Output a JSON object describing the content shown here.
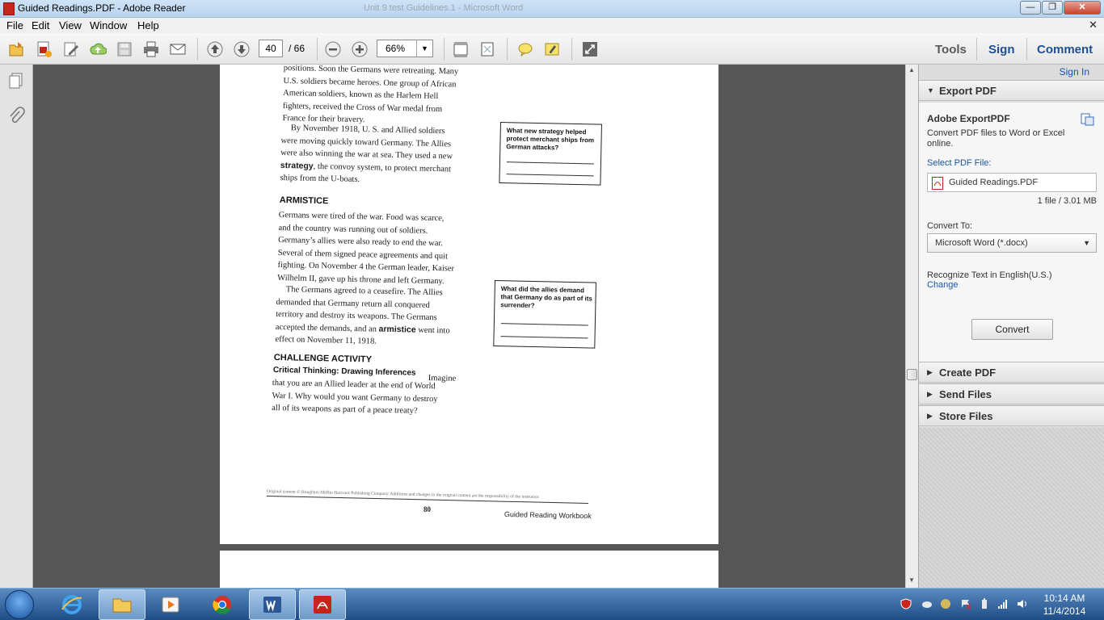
{
  "window": {
    "title": "Guided Readings.PDF - Adobe Reader",
    "ghost_title": "Unit 9 test Guidelines.1 - Microsoft Word",
    "minimize": "—",
    "maximize": "❐",
    "close": "✕"
  },
  "menu": {
    "items": [
      "File",
      "Edit",
      "View",
      "Window",
      "Help"
    ],
    "close_glyph": "✕"
  },
  "toolbar": {
    "current_page": "40",
    "page_total": "/ 66",
    "zoom": "66%",
    "zoom_dropdown": "▼",
    "tools": "Tools",
    "sign": "Sign",
    "comment": "Comment"
  },
  "document": {
    "paragraph1": [
      "positions. Soon the Germans were retreating. Many",
      "U.S. soldiers became heroes. One group of African",
      "American soldiers, known as the Harlem Hell",
      "fighters, received the Cross of War medal from",
      "France for their bravery."
    ],
    "paragraph2": [
      "By November 1918, U. S. and Allied soldiers",
      "were moving quickly toward Germany. The Allies",
      "were also winning the war at sea. They used a new",
      "strategy, the convoy system, to protect merchant",
      "ships from the U-boats."
    ],
    "heading_armistice": "ARMISTICE",
    "paragraph3": [
      "Germans were tired of the war. Food was scarce,",
      "and the country was running out of soldiers.",
      "Germany’s allies were also ready to end the war.",
      "Several of them signed peace agreements and quit",
      "fighting. On November 4 the German leader, Kaiser",
      "Wilhelm II, gave up his throne and left Germany."
    ],
    "paragraph4": [
      "The Germans agreed to a ceasefire. The Allies",
      "demanded that Germany return all conquered",
      "territory and destroy its weapons. The Germans",
      "accepted the demands, and an armistice went into",
      "effect on November 11, 1918."
    ],
    "heading_challenge": "CHALLENGE ACTIVITY",
    "challenge_sub": "Critical Thinking: Drawing Inferences",
    "challenge_text": [
      "Imagine",
      "that you are an Allied leader at the end of World",
      "War I.  Why would you want Germany to destroy",
      "all of its weapons as part of a peace treaty?"
    ],
    "question1": "What new strategy helped protect merchant ships from German attacks?",
    "question2": "What did the allies demand that Germany do as part of its surrender?",
    "footnote": "Original content © Houghton Mifflin Harcourt Publishing Company. Additions and changes to the original content are the responsibility of the instructor.",
    "page_number": "80",
    "workbook": "Guided Reading Workbook"
  },
  "right_pane": {
    "sign_in": "Sign In",
    "export_header": "Export PDF",
    "export_title": "Adobe ExportPDF",
    "export_desc": "Convert PDF files to Word or Excel online.",
    "select_label": "Select PDF File:",
    "file_name": "Guided Readings.PDF",
    "file_size": "1 file / 3.01 MB",
    "convert_to_label": "Convert To:",
    "convert_to_value": "Microsoft Word (*.docx)",
    "recognize": "Recognize Text in English(U.S.)",
    "change": "Change",
    "convert_button": "Convert",
    "sections": [
      "Create PDF",
      "Send Files",
      "Store Files"
    ],
    "expanded_glyph": "▼",
    "collapsed_glyph": "▶"
  },
  "taskbar": {
    "time": "10:14 AM",
    "date": "11/4/2014"
  },
  "colors": {
    "accent": "#1a55a8",
    "pdf_red": "#c8241e",
    "doc_bg": "#565656"
  }
}
